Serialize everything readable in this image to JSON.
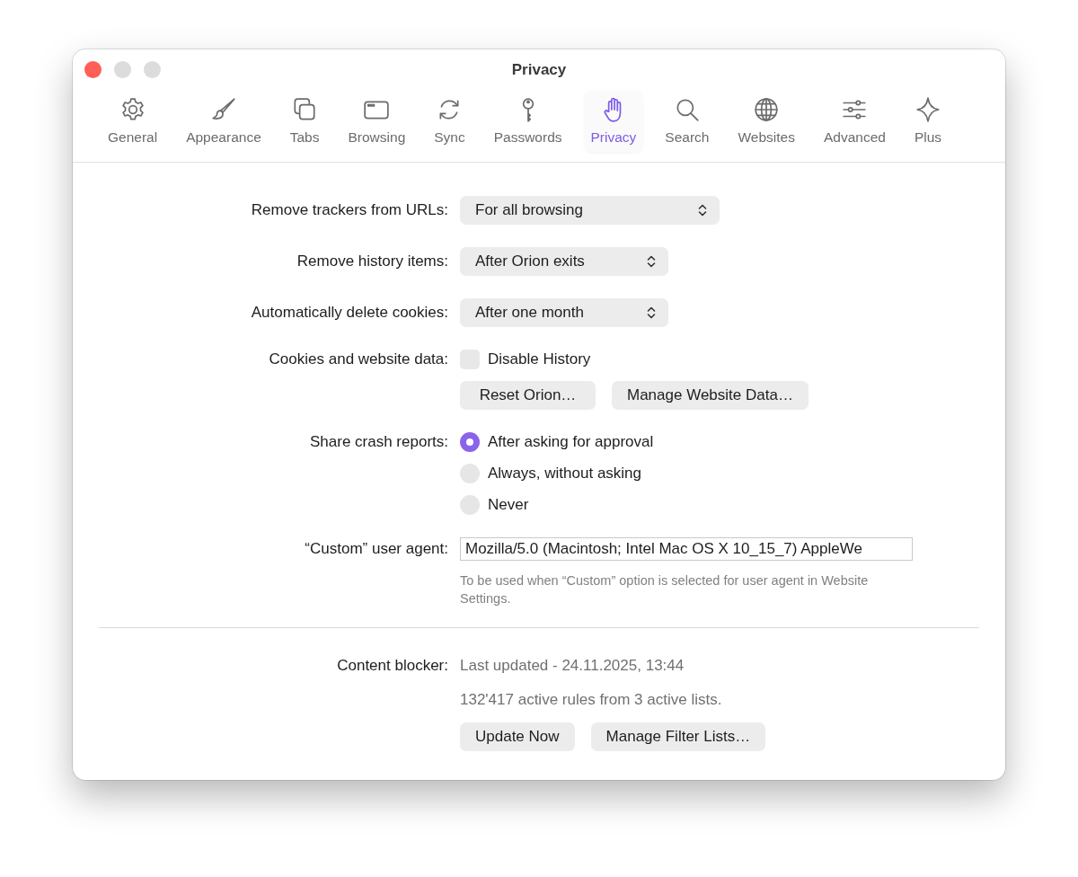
{
  "window": {
    "title": "Privacy",
    "controls": [
      {
        "kind": "close",
        "disabled": false
      },
      {
        "kind": "minimize",
        "disabled": true
      },
      {
        "kind": "zoom",
        "disabled": true
      }
    ]
  },
  "tabs": [
    {
      "label": "General",
      "selected": false
    },
    {
      "label": "Appearance",
      "selected": false
    },
    {
      "label": "Tabs",
      "selected": false
    },
    {
      "label": "Browsing",
      "selected": false
    },
    {
      "label": "Sync",
      "selected": false
    },
    {
      "label": "Passwords",
      "selected": false
    },
    {
      "label": "Privacy",
      "selected": true
    },
    {
      "label": "Search",
      "selected": false
    },
    {
      "label": "Websites",
      "selected": false
    },
    {
      "label": "Advanced",
      "selected": false
    },
    {
      "label": "Plus",
      "selected": false
    }
  ],
  "sections": [
    {
      "rows": [
        {
          "kind": "popup",
          "label": "Remove trackers from URLs:",
          "value": "For all browsing"
        },
        {
          "kind": "popup",
          "label": "Remove history items:",
          "value": "After Orion exits"
        },
        {
          "kind": "popup",
          "label": "Automatically delete cookies:",
          "value": "After one month"
        },
        {
          "kind": "checkbox",
          "label": "Cookies and website data:",
          "text": "Disable History",
          "checked": false
        },
        {
          "kind": "buttons",
          "buttons": [
            "Reset Orion…",
            "Manage Website Data…"
          ]
        },
        {
          "kind": "radio",
          "label": "Share crash reports:",
          "options": [
            {
              "text": "After asking for approval",
              "selected": true
            },
            {
              "text": "Always, without asking",
              "selected": false
            },
            {
              "text": "Never",
              "selected": false
            }
          ]
        },
        {
          "kind": "text_field",
          "label": "“Custom” user agent:",
          "value": "Mozilla/5.0 (Macintosh; Intel Mac OS X 10_15_7) AppleWe",
          "help": "To be used when “Custom” option is selected for user agent in Website Settings."
        }
      ]
    },
    {
      "rows": [
        {
          "kind": "info",
          "label": "Content blocker:",
          "text": "Last updated - 24.11.2025, 13:44"
        },
        {
          "kind": "info",
          "text": "132'417 active rules from 3 active lists."
        },
        {
          "kind": "buttons",
          "buttons": [
            "Update Now",
            "Manage Filter Lists…"
          ]
        }
      ]
    }
  ]
}
